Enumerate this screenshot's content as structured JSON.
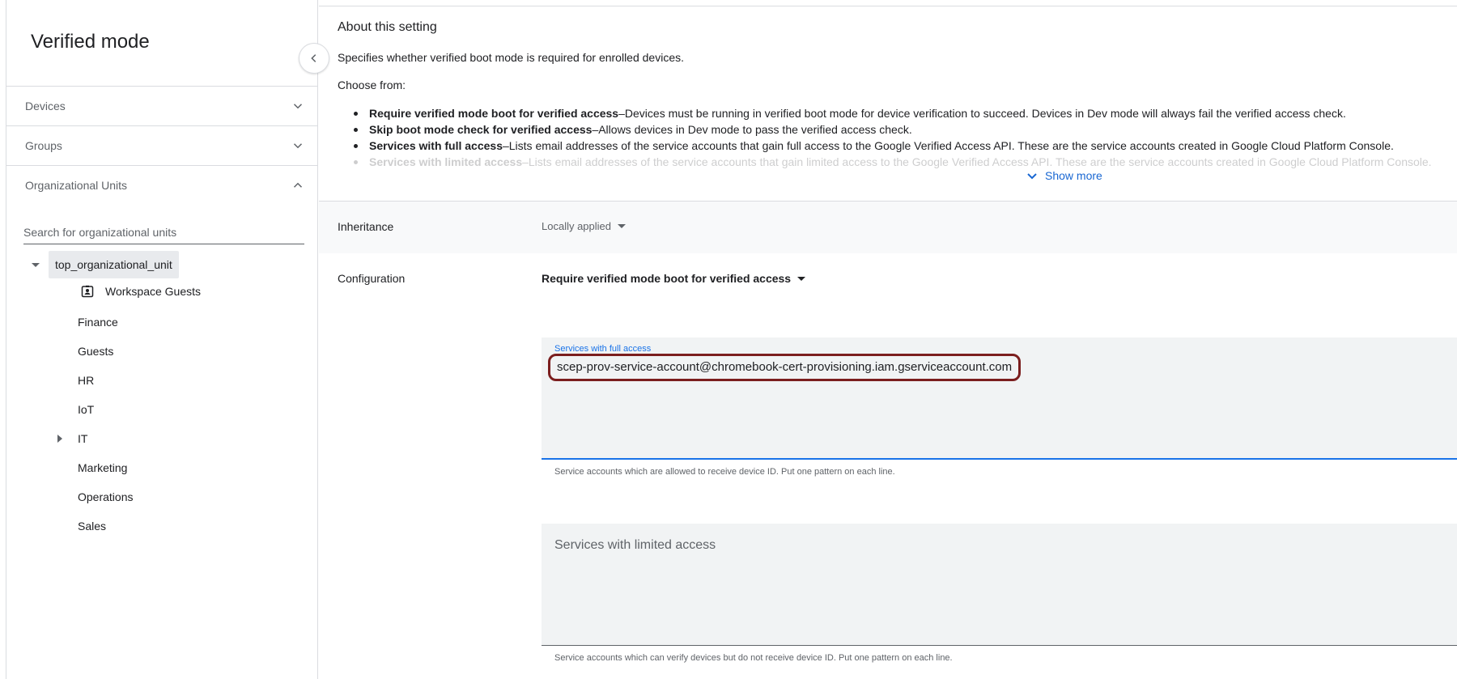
{
  "sidebar": {
    "title": "Verified mode",
    "sections": [
      {
        "label": "Devices",
        "expanded": false
      },
      {
        "label": "Groups",
        "expanded": false
      },
      {
        "label": "Organizational Units",
        "expanded": true
      }
    ],
    "search_placeholder": "Search for organizational units",
    "tree": {
      "root": "top_organizational_unit",
      "children": [
        "Workspace Guests",
        "Finance",
        "Guests",
        "HR",
        "IoT",
        "IT",
        "Marketing",
        "Operations",
        "Sales"
      ]
    }
  },
  "about": {
    "title": "About this setting",
    "description": "Specifies whether verified boot mode is required for enrolled devices.",
    "choose_from": "Choose from:",
    "options": [
      {
        "term": "Require verified mode boot for verified access",
        "text": "–Devices must be running in verified boot mode for device verification to succeed. Devices in Dev mode will always fail the verified access check."
      },
      {
        "term": "Skip boot mode check for verified access",
        "text": "–Allows devices in Dev mode to pass the verified access check."
      },
      {
        "term": "Services with full access",
        "text": "–Lists email addresses of the service accounts that gain full access to the Google Verified Access API. These are the service accounts created in Google Cloud Platform Console."
      },
      {
        "term": "Services with limited access",
        "text": "–Lists email addresses of the service accounts that gain limited access to the Google Verified Access API. These are the service accounts created in Google Cloud Platform Console."
      }
    ],
    "show_more": "Show more"
  },
  "inheritance": {
    "label": "Inheritance",
    "value": "Locally applied"
  },
  "configuration": {
    "label": "Configuration",
    "value": "Require verified mode boot for verified access",
    "full_access": {
      "label": "Services with full access",
      "value": "scep-prov-service-account@chromebook-cert-provisioning.iam.gserviceaccount.com",
      "helper": "Service accounts which are allowed to receive device ID. Put one pattern on each line."
    },
    "limited_access": {
      "placeholder": "Services with limited access",
      "helper": "Service accounts which can verify devices but do not receive device ID. Put one pattern on each line."
    }
  },
  "colors": {
    "link": "#1967d2",
    "focus": "#1a73e8",
    "highlight_box": "#7b1e1e"
  }
}
